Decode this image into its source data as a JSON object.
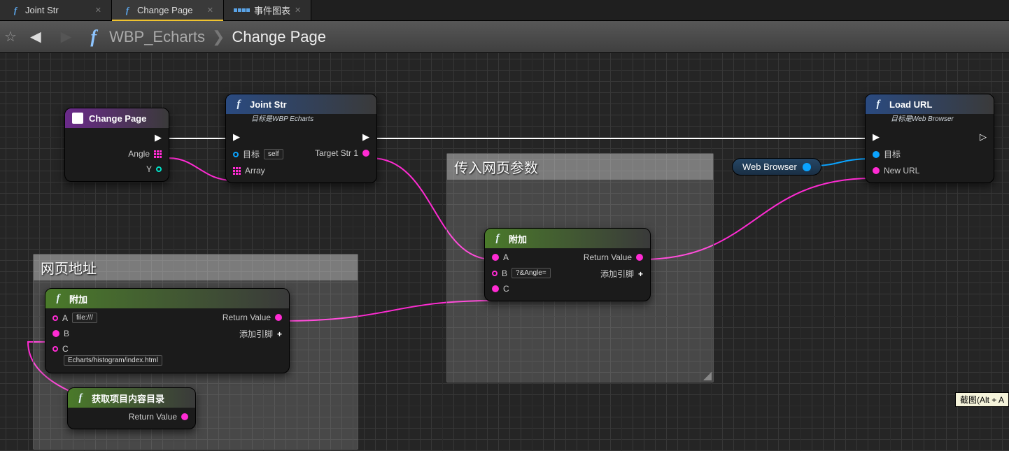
{
  "tabs": [
    {
      "label": "Joint Str",
      "type": "func",
      "active": false
    },
    {
      "label": "Change Page",
      "type": "func",
      "active": true
    },
    {
      "label": "事件图表",
      "type": "graph",
      "active": false
    }
  ],
  "breadcrumb": {
    "root": "WBP_Echarts",
    "current": "Change Page"
  },
  "nodes": {
    "entry": {
      "title": "Change Page",
      "pins": {
        "angle": "Angle",
        "y": "Y"
      }
    },
    "jointStr": {
      "title": "Joint Str",
      "subtitle": "目标是WBP Echarts",
      "pins": {
        "target": "目标",
        "self": "self",
        "array": "Array",
        "out": "Target Str 1"
      }
    },
    "append1": {
      "title": "附加",
      "pins": {
        "a": "A",
        "a_value": "file:///",
        "b": "B",
        "c": "C",
        "c_value": "Echarts/histogram/index.html",
        "rv": "Return Value",
        "addPin": "添加引脚"
      }
    },
    "getDir": {
      "title": "获取项目内容目录",
      "pins": {
        "rv": "Return Value"
      }
    },
    "append2": {
      "title": "附加",
      "pins": {
        "a": "A",
        "b": "B",
        "b_value": "?&Angle=",
        "c": "C",
        "rv": "Return Value",
        "addPin": "添加引脚"
      }
    },
    "loadUrl": {
      "title": "Load URL",
      "subtitle": "目标是Web Browser",
      "pins": {
        "target": "目标",
        "newUrl": "New URL"
      }
    }
  },
  "comments": {
    "addr": "网页地址",
    "params": "传入网页参数"
  },
  "variable": {
    "name": "Web Browser"
  },
  "tooltip": "截图(Alt + A"
}
